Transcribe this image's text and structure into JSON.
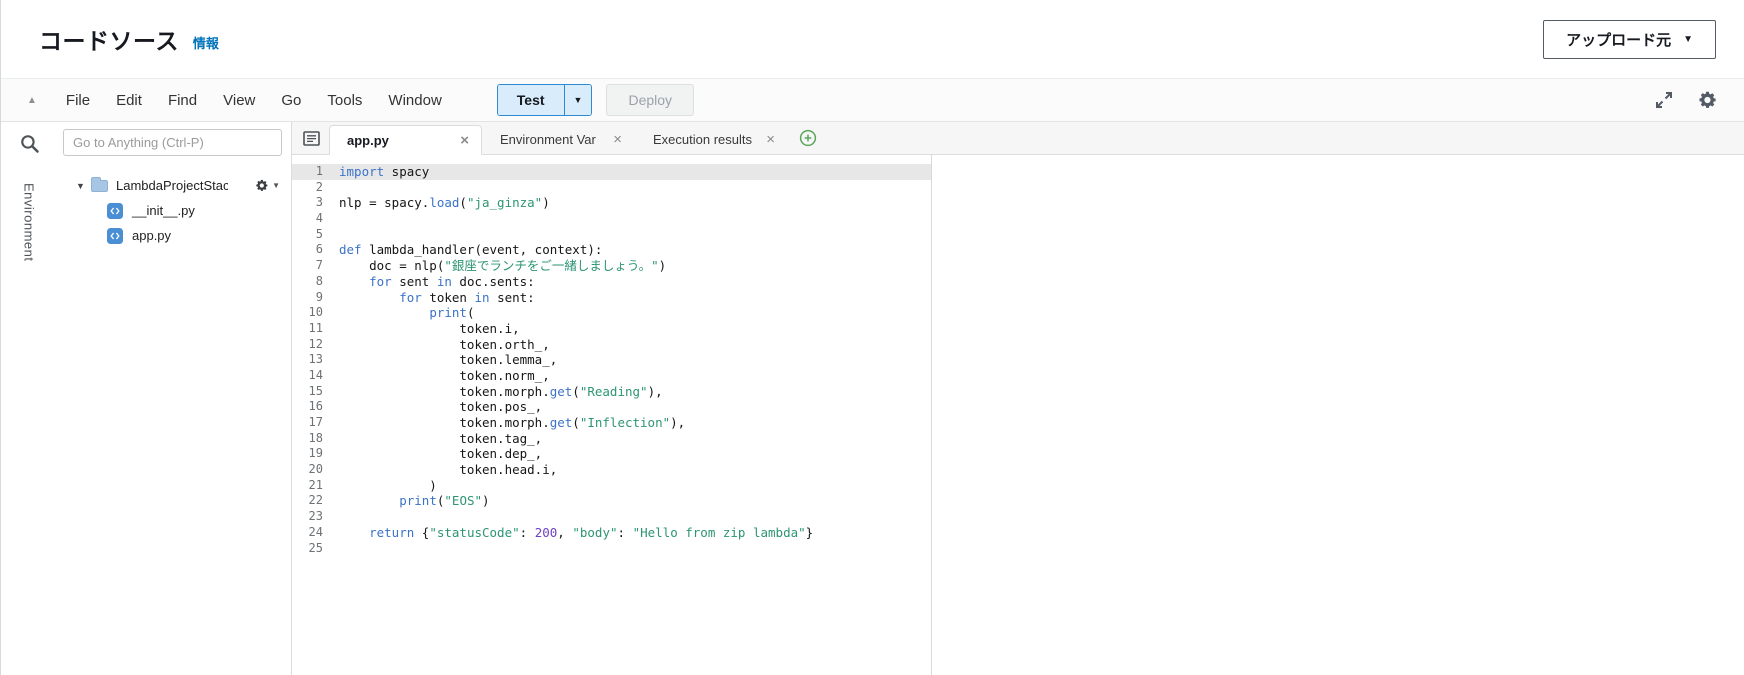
{
  "icons": {
    "close": "×",
    "caret_down": "▼",
    "collapse_up": "▲",
    "disclosure_down": "▼"
  },
  "header": {
    "title": "コードソース",
    "info_link": "情報",
    "upload_button": "アップロード元"
  },
  "menubar": {
    "items": [
      "File",
      "Edit",
      "Find",
      "View",
      "Go",
      "Tools",
      "Window"
    ],
    "test_label": "Test",
    "deploy_label": "Deploy"
  },
  "sidebar": {
    "goto_placeholder": "Go to Anything (Ctrl-P)",
    "environment_label": "Environment",
    "tree": {
      "folder": "LambdaProjectStack",
      "files": [
        "__init__.py",
        "app.py"
      ]
    }
  },
  "tabs": [
    {
      "label": "app.py"
    },
    {
      "label": "Environment Var"
    },
    {
      "label": "Execution results"
    }
  ],
  "editor": {
    "active_line": 1,
    "lines": [
      [
        [
          "kw",
          "import"
        ],
        [
          "pl",
          " spacy"
        ]
      ],
      [],
      [
        [
          "pl",
          "nlp = spacy."
        ],
        [
          "kw",
          "load"
        ],
        [
          "pl",
          "("
        ],
        [
          "str",
          "\"ja_ginza\""
        ],
        [
          "pl",
          ")"
        ]
      ],
      [],
      [],
      [
        [
          "kw",
          "def"
        ],
        [
          "pl",
          " lambda_handler(event, context):"
        ]
      ],
      [
        [
          "pl",
          "    doc = nlp("
        ],
        [
          "str",
          "\"銀座でランチをご一緒しましょう。\""
        ],
        [
          "pl",
          ")"
        ]
      ],
      [
        [
          "pl",
          "    "
        ],
        [
          "kw",
          "for"
        ],
        [
          "pl",
          " sent "
        ],
        [
          "kw",
          "in"
        ],
        [
          "pl",
          " doc.sents:"
        ]
      ],
      [
        [
          "pl",
          "        "
        ],
        [
          "kw",
          "for"
        ],
        [
          "pl",
          " token "
        ],
        [
          "kw",
          "in"
        ],
        [
          "pl",
          " sent:"
        ]
      ],
      [
        [
          "pl",
          "            "
        ],
        [
          "kw",
          "print"
        ],
        [
          "pl",
          "("
        ]
      ],
      [
        [
          "pl",
          "                token.i,"
        ]
      ],
      [
        [
          "pl",
          "                token.orth_,"
        ]
      ],
      [
        [
          "pl",
          "                token.lemma_,"
        ]
      ],
      [
        [
          "pl",
          "                token.norm_,"
        ]
      ],
      [
        [
          "pl",
          "                token.morph."
        ],
        [
          "kw",
          "get"
        ],
        [
          "pl",
          "("
        ],
        [
          "str",
          "\"Reading\""
        ],
        [
          "pl",
          "),"
        ]
      ],
      [
        [
          "pl",
          "                token.pos_,"
        ]
      ],
      [
        [
          "pl",
          "                token.morph."
        ],
        [
          "kw",
          "get"
        ],
        [
          "pl",
          "("
        ],
        [
          "str",
          "\"Inflection\""
        ],
        [
          "pl",
          "),"
        ]
      ],
      [
        [
          "pl",
          "                token.tag_,"
        ]
      ],
      [
        [
          "pl",
          "                token.dep_,"
        ]
      ],
      [
        [
          "pl",
          "                token.head.i,"
        ]
      ],
      [
        [
          "pl",
          "            )"
        ]
      ],
      [
        [
          "pl",
          "        "
        ],
        [
          "kw",
          "print"
        ],
        [
          "pl",
          "("
        ],
        [
          "str",
          "\"EOS\""
        ],
        [
          "pl",
          ")"
        ]
      ],
      [],
      [
        [
          "pl",
          "    "
        ],
        [
          "kw",
          "return"
        ],
        [
          "pl",
          " {"
        ],
        [
          "str",
          "\"statusCode\""
        ],
        [
          "pl",
          ": "
        ],
        [
          "num",
          "200"
        ],
        [
          "pl",
          ", "
        ],
        [
          "str",
          "\"body\""
        ],
        [
          "pl",
          ": "
        ],
        [
          "str",
          "\"Hello from zip lambda\""
        ],
        [
          "pl",
          "}"
        ]
      ],
      []
    ]
  }
}
